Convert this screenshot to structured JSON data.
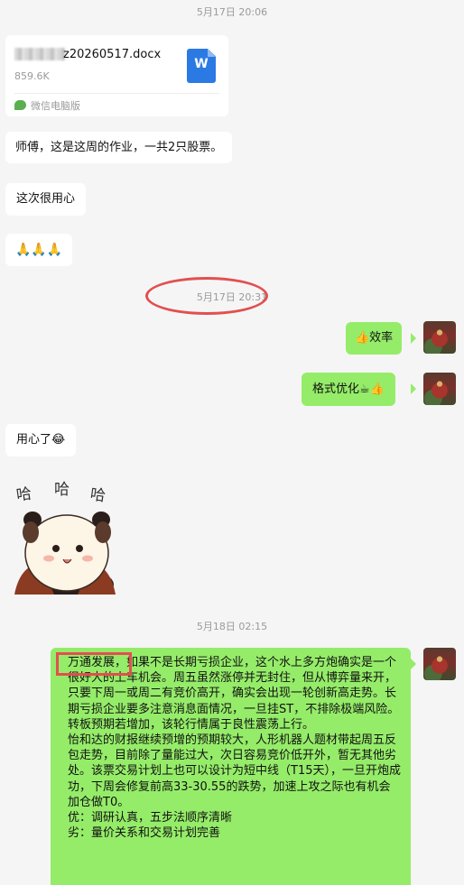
{
  "timestamps": {
    "t1": "5月17日 20:06",
    "t2": "5月17日 20:31",
    "t3": "5月18日 02:15"
  },
  "file": {
    "name": "z20260517.docx",
    "size": "859.6K",
    "icon_letter": "W",
    "source": "微信电脑版"
  },
  "messages": {
    "m1": "师傅，这是这周的作业，一共2只股票。",
    "m2": "这次很用心",
    "m3": "🙏🙏🙏",
    "m4": "👍效率",
    "m5": "格式优化☕👍",
    "m6": "用心了😂"
  },
  "sticker": {
    "text1": "哈",
    "text2": "哈",
    "text3": "哈"
  },
  "long_message": {
    "highlight": "万通发展，",
    "p1": "如果不是长期亏损企业，这个水上多方炮确实是一个很好大的上车机会。周五虽然涨停并无封住，但从博弈量来开，只要下周一或周二有竞价高开，确实会出现一轮创新高走势。长期亏损企业要多注意消息面情况，一旦挂ST，不排除极端风险。转板预期若增加，该轮行情属于良性震荡上行。",
    "p2": "怡和达的财报继续预增的预期较大，人形机器人题材带起周五反包走势，目前除了量能过大，次日容易竞价低开外，暂无其他劣处。该票交易计划上也可以设计为短中线（T15天），一旦开炮成功，下周会修复前高33-30.55的跌势，加速上攻之际也有机会加仓做T0。",
    "p3": "优：调研认真，五步法顺序清晰",
    "p4": "劣：量价关系和交易计划完善"
  },
  "colors": {
    "bubble_out": "#95ec69",
    "bubble_in": "#ffffff",
    "annotation_red": "#e24f4f",
    "background": "#f5f5f5"
  }
}
